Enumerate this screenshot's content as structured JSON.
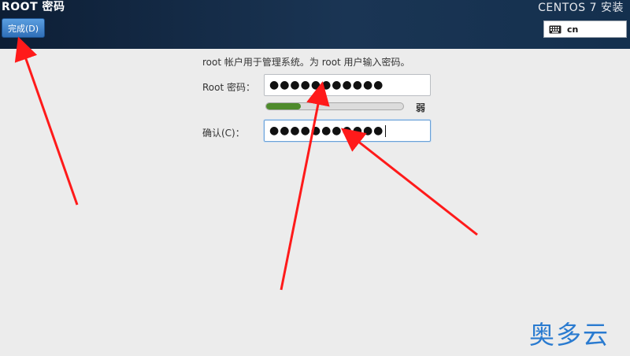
{
  "header": {
    "screen_title": "ROOT 密码",
    "product_title": "CENTOS 7 安装",
    "done_button": "完成(D)",
    "keyboard_layout": "cn"
  },
  "form": {
    "instruction": "root 帐户用于管理系统。为 root 用户输入密码。",
    "root_password_label": "Root 密码：",
    "root_password_value": "●●●●●●●●●●●",
    "confirm_label": "确认(C)：",
    "confirm_value": "●●●●●●●●●●●",
    "strength_label": "弱",
    "strength_level": 0.25
  },
  "watermark": "奥多云",
  "colors": {
    "header_bg": "#14304e",
    "button_blue": "#3e7fc6",
    "strength_green": "#4e8b2c",
    "annotation_red": "#ff1a1a",
    "watermark_blue": "#2a7bd0"
  },
  "icons": {
    "keyboard": "keyboard-icon"
  }
}
